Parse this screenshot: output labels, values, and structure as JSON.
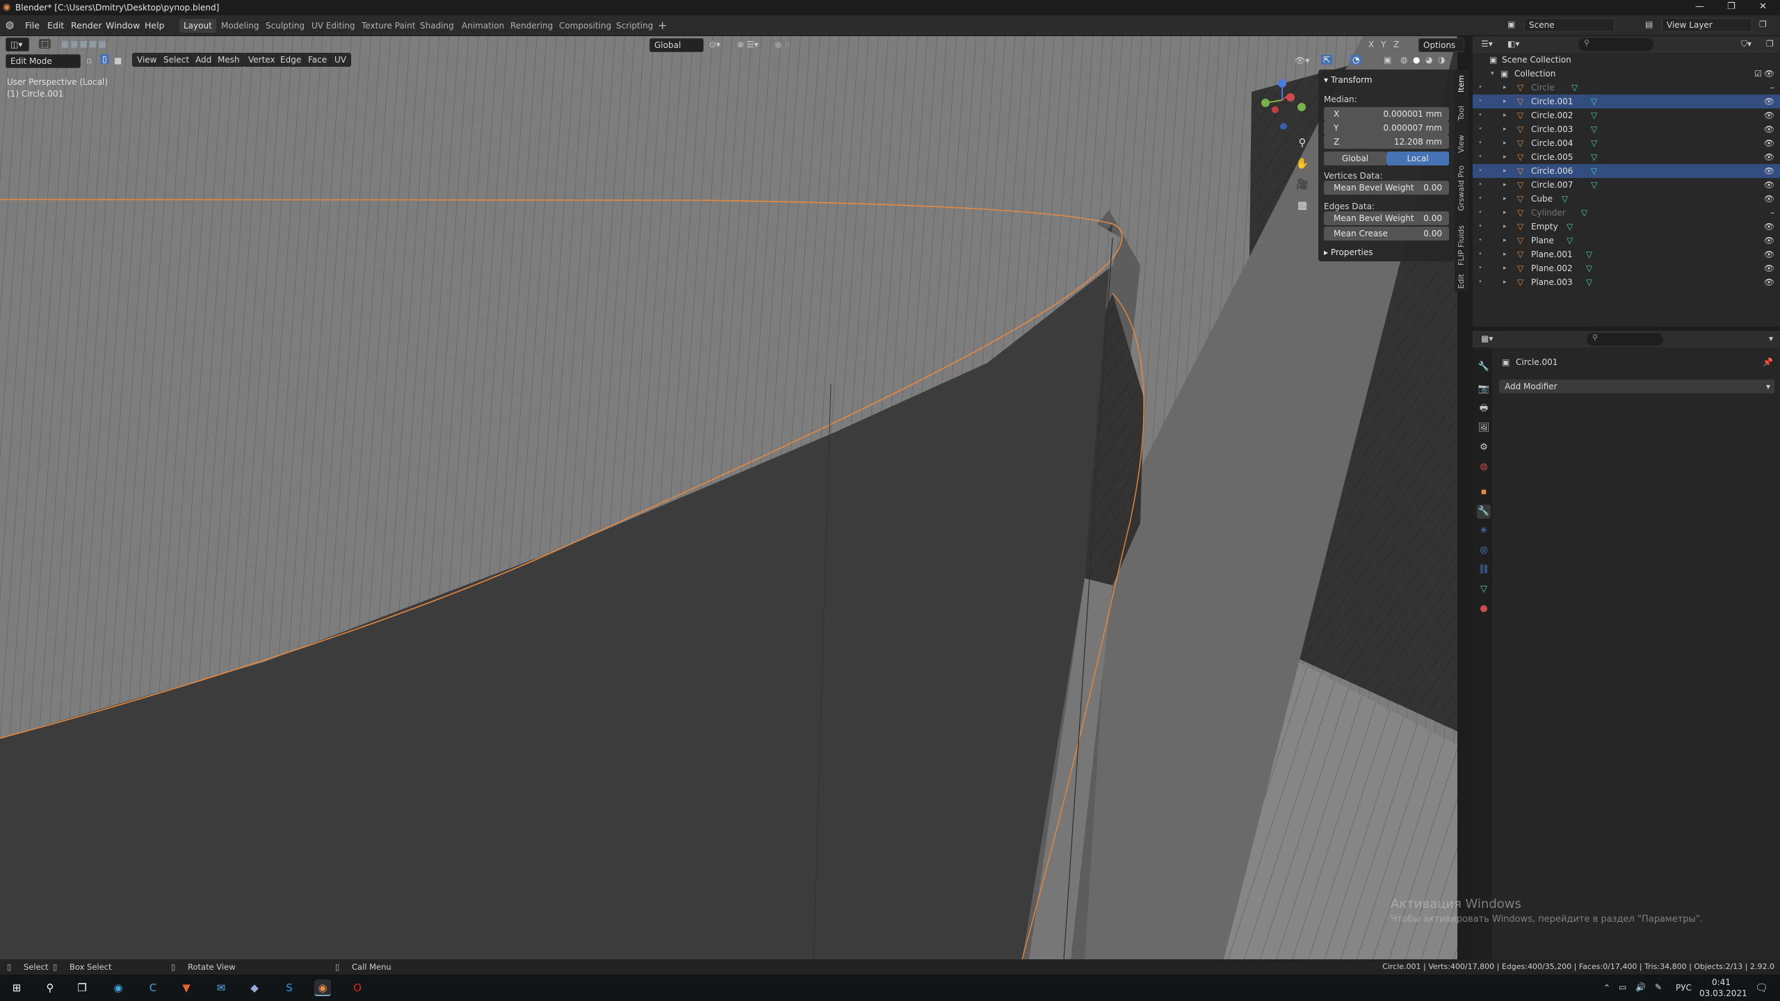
{
  "window": {
    "title": "Blender* [C:\\Users\\Dmitry\\Desktop\\рупор.blend]"
  },
  "menu": [
    "File",
    "Edit",
    "Render",
    "Window",
    "Help"
  ],
  "workspaces": [
    "Layout",
    "Modeling",
    "Sculpting",
    "UV Editing",
    "Texture Paint",
    "Shading",
    "Animation",
    "Rendering",
    "Compositing",
    "Scripting"
  ],
  "active_workspace": "Layout",
  "topbar": {
    "scene": "Scene",
    "view_layer": "View Layer",
    "transform_orientation": "Global",
    "options": "Options",
    "axes": [
      "X",
      "Y",
      "Z"
    ]
  },
  "viewport_header": {
    "mode": "Edit Mode",
    "menus": [
      "View",
      "Select",
      "Add",
      "Mesh",
      "Vertex",
      "Edge",
      "Face",
      "UV"
    ]
  },
  "viewport": {
    "perspective": "User Perspective (Local)",
    "object": "(1) Circle.001"
  },
  "npanel": {
    "section": "Transform",
    "median_label": "Median:",
    "x": {
      "label": "X",
      "value": "0.000001 mm"
    },
    "y": {
      "label": "Y",
      "value": "0.000007 mm"
    },
    "z": {
      "label": "Z",
      "value": "12.208 mm"
    },
    "global": "Global",
    "local": "Local",
    "vertices_label": "Vertices Data:",
    "mean_bevel_v": {
      "label": "Mean Bevel Weight",
      "value": "0.00"
    },
    "edges_label": "Edges Data:",
    "mean_bevel_e": {
      "label": "Mean Bevel Weight",
      "value": "0.00"
    },
    "mean_crease": {
      "label": "Mean Crease",
      "value": "0.00"
    },
    "properties": "Properties",
    "tabs": [
      "Item",
      "Tool",
      "View",
      "Grswald Pro",
      "FLIP Fluids",
      "Edit"
    ]
  },
  "outliner": {
    "root": "Scene Collection",
    "collection": "Collection",
    "items": [
      {
        "name": "Circle",
        "dim": true,
        "sel": false
      },
      {
        "name": "Circle.001",
        "dim": false,
        "sel": true
      },
      {
        "name": "Circle.002",
        "dim": false,
        "sel": false
      },
      {
        "name": "Circle.003",
        "dim": false,
        "sel": false
      },
      {
        "name": "Circle.004",
        "dim": false,
        "sel": false
      },
      {
        "name": "Circle.005",
        "dim": false,
        "sel": false
      },
      {
        "name": "Circle.006",
        "dim": false,
        "sel": true
      },
      {
        "name": "Circle.007",
        "dim": false,
        "sel": false
      },
      {
        "name": "Cube",
        "dim": false,
        "sel": false
      },
      {
        "name": "Cylinder",
        "dim": true,
        "sel": false
      },
      {
        "name": "Empty",
        "dim": false,
        "sel": false
      },
      {
        "name": "Plane",
        "dim": false,
        "sel": false
      },
      {
        "name": "Plane.001",
        "dim": false,
        "sel": false
      },
      {
        "name": "Plane.002",
        "dim": false,
        "sel": false
      },
      {
        "name": "Plane.003",
        "dim": false,
        "sel": false
      }
    ]
  },
  "properties": {
    "object": "Circle.001",
    "add_modifier": "Add Modifier"
  },
  "status": {
    "select": "Select",
    "box_select": "Box Select",
    "rotate": "Rotate View",
    "call_menu": "Call Menu",
    "stats": "Circle.001 | Verts:400/17,800 | Edges:400/35,200 | Faces:0/17,400 | Tris:34,800 | Objects:2/13 | 2.92.0"
  },
  "watermark": {
    "line1": "Активация Windows",
    "line2": "Чтобы активировать Windows, перейдите в раздел \"Параметры\"."
  },
  "taskbar": {
    "lang": "РУС",
    "time": "0:41",
    "date": "03.03.2021"
  }
}
